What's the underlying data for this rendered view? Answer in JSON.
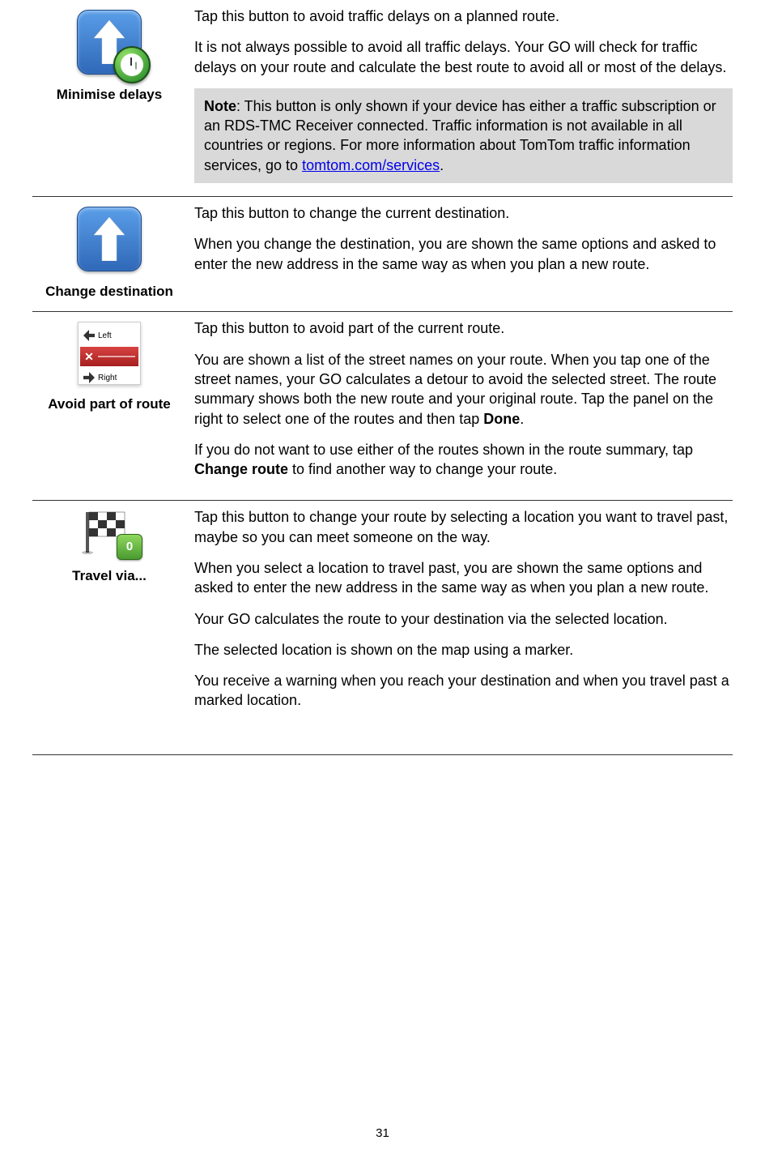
{
  "page_number": "31",
  "sections": [
    {
      "id": "minimise",
      "label": "Minimise delays",
      "icon": "arrow-clock",
      "paragraphs": [
        "Tap this button to avoid traffic delays on a planned route.",
        "It is not always possible to avoid all traffic delays. Your GO will check for traffic delays on your route and calculate the best route to avoid all or most of the delays."
      ],
      "note": {
        "label": "Note",
        "text_before_link": ": This button is only shown if your device has either a traffic subscription or an RDS-TMC Receiver connected. Traffic information is not available in all countries or regions. For more information about TomTom traffic information services, go to ",
        "link_text": "tomtom.com/services",
        "link_href": "tomtom.com/services",
        "text_after_link": "."
      }
    },
    {
      "id": "change",
      "label": "Change destination",
      "icon": "arrow",
      "paragraphs": [
        "Tap this button to change the current destination.",
        "When you change the destination, you are shown the same options and asked to enter the new address in the same way as when you plan a new route."
      ]
    },
    {
      "id": "avoid",
      "label": "Avoid part of route",
      "icon": "avoid-list",
      "rich_paragraphs": [
        {
          "parts": [
            {
              "t": "Tap this button to avoid part of the current route."
            }
          ]
        },
        {
          "parts": [
            {
              "t": "You are shown a list of the street names on your route. When you tap one of the street names, your GO calculates a detour to avoid the selected street. The route summary shows both the new route and your original route. Tap the panel on the right to select one of the routes and then tap "
            },
            {
              "t": "Done",
              "bold": true
            },
            {
              "t": "."
            }
          ]
        },
        {
          "parts": [
            {
              "t": "If you do not want to use either of the routes shown in the route summary, tap "
            },
            {
              "t": "Change route",
              "bold": true
            },
            {
              "t": " to find another way to change your route."
            }
          ]
        }
      ],
      "avoid_rows": {
        "left": "Left",
        "right": "Right"
      }
    },
    {
      "id": "travel",
      "label": "Travel via...",
      "icon": "flag",
      "flag_badge": "0",
      "paragraphs": [
        "Tap this button to change your route by selecting a location you want to travel past, maybe so you can meet someone on the way.",
        "When you select a location to travel past, you are shown the same options and asked to enter the new address in the same way as when you plan a new route.",
        "Your GO calculates the route to your destination via the selected location.",
        "The selected location is shown on the map using a marker.",
        "You receive a warning when you reach your destination and when you travel past a marked location."
      ]
    }
  ]
}
